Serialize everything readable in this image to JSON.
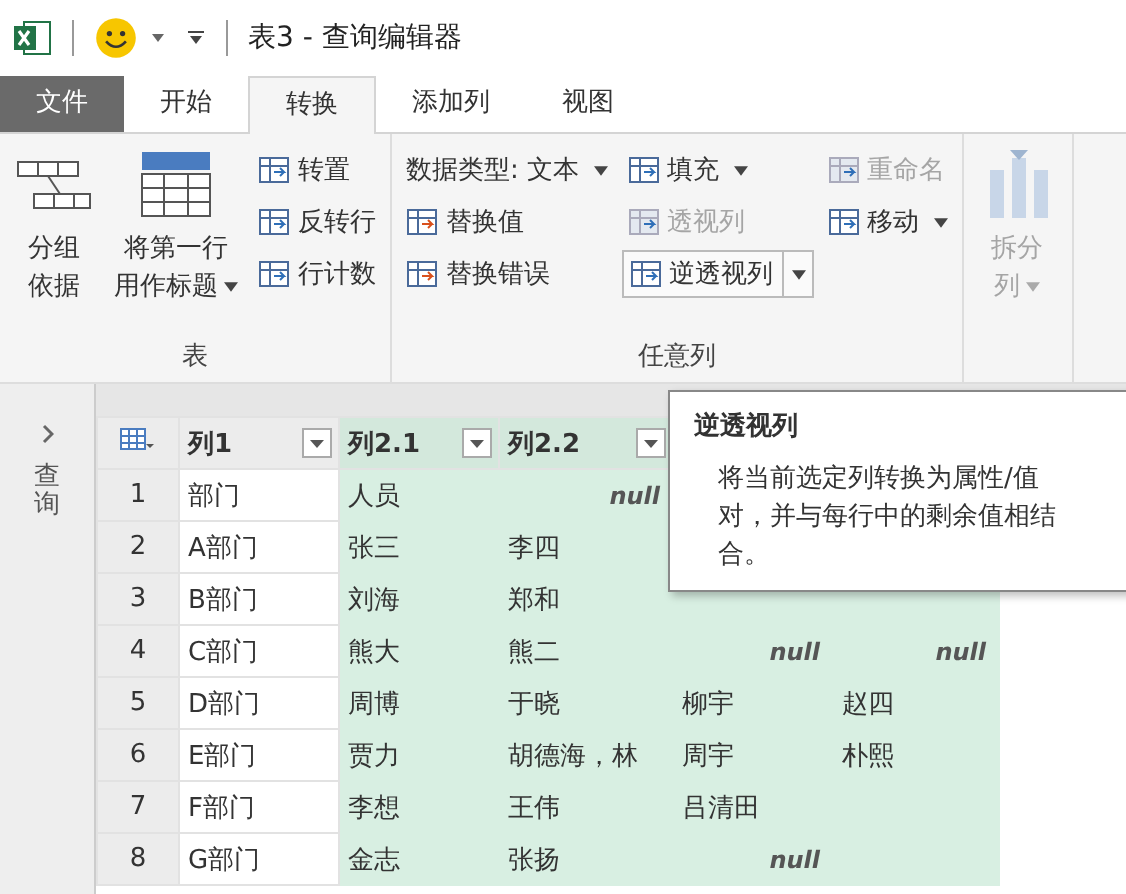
{
  "window": {
    "title": "表3 - 查询编辑器"
  },
  "tabs": [
    {
      "label": "文件",
      "kind": "file",
      "selected": false
    },
    {
      "label": "开始",
      "kind": "tab",
      "selected": false
    },
    {
      "label": "转换",
      "kind": "tab",
      "selected": true
    },
    {
      "label": "添加列",
      "kind": "tab",
      "selected": false
    },
    {
      "label": "视图",
      "kind": "tab",
      "selected": false
    }
  ],
  "ribbon": {
    "groups": [
      {
        "label": "表",
        "buttons": [
          {
            "kind": "large",
            "lines": [
              "分组",
              "依据"
            ],
            "dropdown": false,
            "disabled": false
          },
          {
            "kind": "large",
            "lines": [
              "将第一行",
              "用作标题"
            ],
            "dropdown": true,
            "disabled": false
          },
          {
            "kind": "small",
            "lines": [
              "转置"
            ],
            "dropdown": false,
            "disabled": false
          },
          {
            "kind": "small",
            "lines": [
              "反转行"
            ],
            "dropdown": false,
            "disabled": false
          },
          {
            "kind": "small",
            "lines": [
              "行计数"
            ],
            "dropdown": false,
            "disabled": false
          }
        ]
      },
      {
        "label": "任意列",
        "buttons": [
          {
            "kind": "small",
            "lines": [
              "数据类型: 文本"
            ],
            "dropdown": true,
            "disabled": false
          },
          {
            "kind": "small",
            "lines": [
              "替换值"
            ],
            "dropdown": false,
            "disabled": false
          },
          {
            "kind": "small",
            "lines": [
              "替换错误"
            ],
            "dropdown": false,
            "disabled": false
          },
          {
            "kind": "small",
            "lines": [
              "填充"
            ],
            "dropdown": true,
            "disabled": false
          },
          {
            "kind": "small",
            "lines": [
              "透视列"
            ],
            "dropdown": false,
            "disabled": true
          },
          {
            "kind": "split",
            "lines": [
              "逆透视列"
            ],
            "dropdown": true,
            "disabled": false
          },
          {
            "kind": "small",
            "lines": [
              "重命名"
            ],
            "dropdown": false,
            "disabled": true
          },
          {
            "kind": "small",
            "lines": [
              "移动"
            ],
            "dropdown": true,
            "disabled": false
          }
        ]
      },
      {
        "buttons": [
          {
            "kind": "large",
            "lines": [
              "拆分",
              "列"
            ],
            "dropdown": true,
            "disabled": true
          }
        ]
      }
    ]
  },
  "query_pane": {
    "label": "查询"
  },
  "table": {
    "columns": [
      {
        "name": "列1",
        "selected": false
      },
      {
        "name": "列2.1",
        "selected": true
      },
      {
        "name": "列2.2",
        "selected": true
      },
      {
        "selected": true
      },
      {
        "selected": true
      }
    ],
    "rows": [
      {
        "number": "1",
        "cells": [
          {
            "kind": "value",
            "text": "部门"
          },
          {
            "kind": "value",
            "text": "人员"
          },
          {
            "kind": "null",
            "text": "null"
          },
          null,
          null
        ]
      },
      {
        "number": "2",
        "cells": [
          {
            "kind": "value",
            "text": "A部门"
          },
          {
            "kind": "value",
            "text": "张三"
          },
          {
            "kind": "value",
            "text": "李四"
          },
          null,
          null
        ]
      },
      {
        "number": "3",
        "cells": [
          {
            "kind": "value",
            "text": "B部门"
          },
          {
            "kind": "value",
            "text": "刘海"
          },
          {
            "kind": "value",
            "text": "郑和"
          },
          null,
          null
        ]
      },
      {
        "number": "4",
        "cells": [
          {
            "kind": "value",
            "text": "C部门"
          },
          {
            "kind": "value",
            "text": "熊大"
          },
          {
            "kind": "value",
            "text": "熊二"
          },
          {
            "kind": "null",
            "text": "null"
          },
          {
            "kind": "null",
            "text": "null"
          }
        ]
      },
      {
        "number": "5",
        "cells": [
          {
            "kind": "value",
            "text": "D部门"
          },
          {
            "kind": "value",
            "text": "周博"
          },
          {
            "kind": "value",
            "text": "于晓"
          },
          {
            "kind": "value",
            "text": "柳宇"
          },
          {
            "kind": "value",
            "text": "赵四"
          }
        ]
      },
      {
        "number": "6",
        "cells": [
          {
            "kind": "value",
            "text": "E部门"
          },
          {
            "kind": "value",
            "text": "贾力"
          },
          {
            "kind": "value",
            "text": "胡德海，林"
          },
          {
            "kind": "value",
            "text": "周宇"
          },
          {
            "kind": "value",
            "text": "朴熙"
          }
        ]
      },
      {
        "number": "7",
        "cells": [
          {
            "kind": "value",
            "text": "F部门"
          },
          {
            "kind": "value",
            "text": "李想"
          },
          {
            "kind": "value",
            "text": "王伟"
          },
          {
            "kind": "value",
            "text": "吕清田"
          },
          null
        ]
      },
      {
        "number": "8",
        "cells": [
          {
            "kind": "value",
            "text": "G部门"
          },
          {
            "kind": "value",
            "text": "金志"
          },
          {
            "kind": "value",
            "text": "张扬"
          },
          {
            "kind": "null",
            "text": "null"
          },
          null
        ]
      }
    ]
  },
  "tooltip": {
    "title": "逆透视列",
    "text": "将当前选定列转换为属性/值对，并与每行中的剩余值相结合。"
  }
}
